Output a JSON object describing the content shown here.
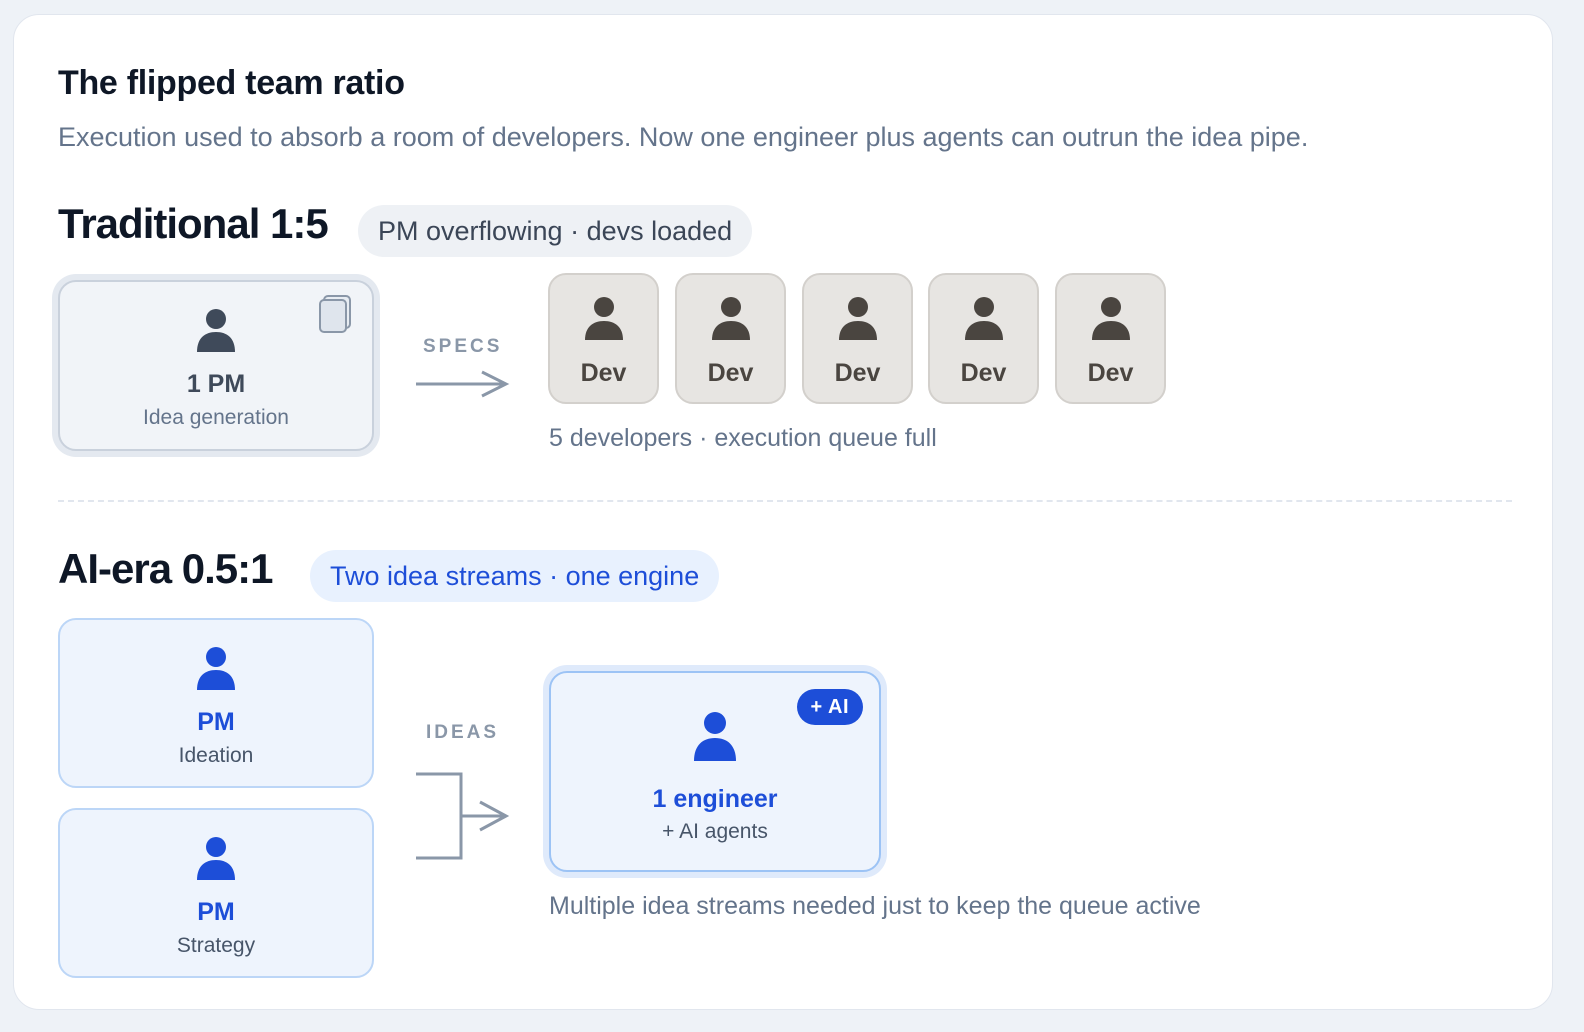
{
  "header": {
    "title": "The flipped team ratio",
    "subtitle": "Execution used to absorb a room of developers. Now one engineer plus agents can outrun the idea pipe."
  },
  "traditional": {
    "heading": "Traditional 1:5",
    "pill": "PM overflowing · devs loaded",
    "pm_label": "1 PM",
    "pm_sub": "Idea generation",
    "flow_label": "SPECS",
    "devs": [
      "Dev",
      "Dev",
      "Dev",
      "Dev",
      "Dev"
    ],
    "caption": "5 developers · execution queue full"
  },
  "ai_era": {
    "heading": "AI-era 0.5:1",
    "pill": "Two idea streams · one engine",
    "pm1_label": "PM",
    "pm1_sub": "Ideation",
    "pm2_label": "PM",
    "pm2_sub": "Strategy",
    "flow_label": "IDEAS",
    "badge": "+ AI",
    "engineer_label": "1 engineer",
    "engineer_sub": "+ AI agents",
    "caption": "Multiple idea streams needed just to keep the queue active"
  },
  "colors": {
    "accent_blue": "#1d4ed8",
    "dark_text": "#0e1726",
    "muted_text": "#64748b",
    "dev_fill": "#e7e5e2",
    "person_gray": "#3f4a5a",
    "person_brown": "#4a4540"
  },
  "icons": {
    "person": "person-icon",
    "document": "document-stack-icon",
    "arrow": "arrow-right-icon",
    "merge_arrow": "merge-arrow-icon"
  }
}
